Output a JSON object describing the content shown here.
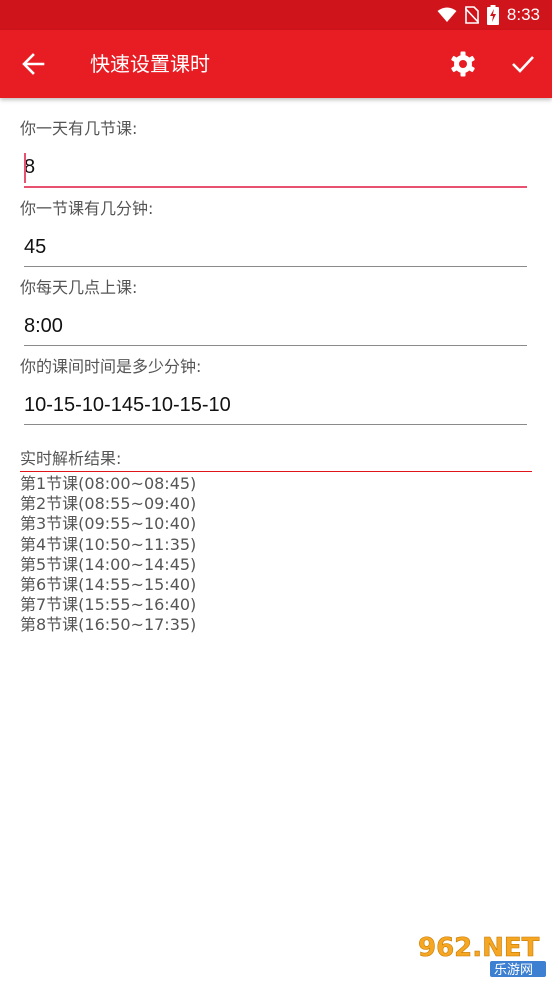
{
  "status_bar": {
    "time": "8:33",
    "icons": [
      "wifi-icon",
      "no-sim-icon",
      "battery-charging-icon"
    ]
  },
  "toolbar": {
    "title": "快速设置课时",
    "back_icon": "arrow-left-icon",
    "settings_icon": "gear-icon",
    "confirm_icon": "check-icon",
    "color": "#e81c23"
  },
  "form": {
    "fields": [
      {
        "label": "你一天有几节课:",
        "value": "8"
      },
      {
        "label": "你一节课有几分钟:",
        "value": "45"
      },
      {
        "label": "你每天几点上课:",
        "value": "8:00"
      },
      {
        "label": "你的课间时间是多少分钟:",
        "value": "10-15-10-145-10-15-10"
      }
    ]
  },
  "result": {
    "header": "实时解析结果:",
    "items": [
      "第1节课(08:00~08:45)",
      "第2节课(08:55~09:40)",
      "第3节课(09:55~10:40)",
      "第4节课(10:50~11:35)",
      "第5节课(14:00~14:45)",
      "第6节课(14:55~15:40)",
      "第7节课(15:55~16:40)",
      "第8节课(16:50~17:35)"
    ]
  },
  "watermark": {
    "text_top": "962.NET",
    "text_bottom": "乐游网"
  }
}
